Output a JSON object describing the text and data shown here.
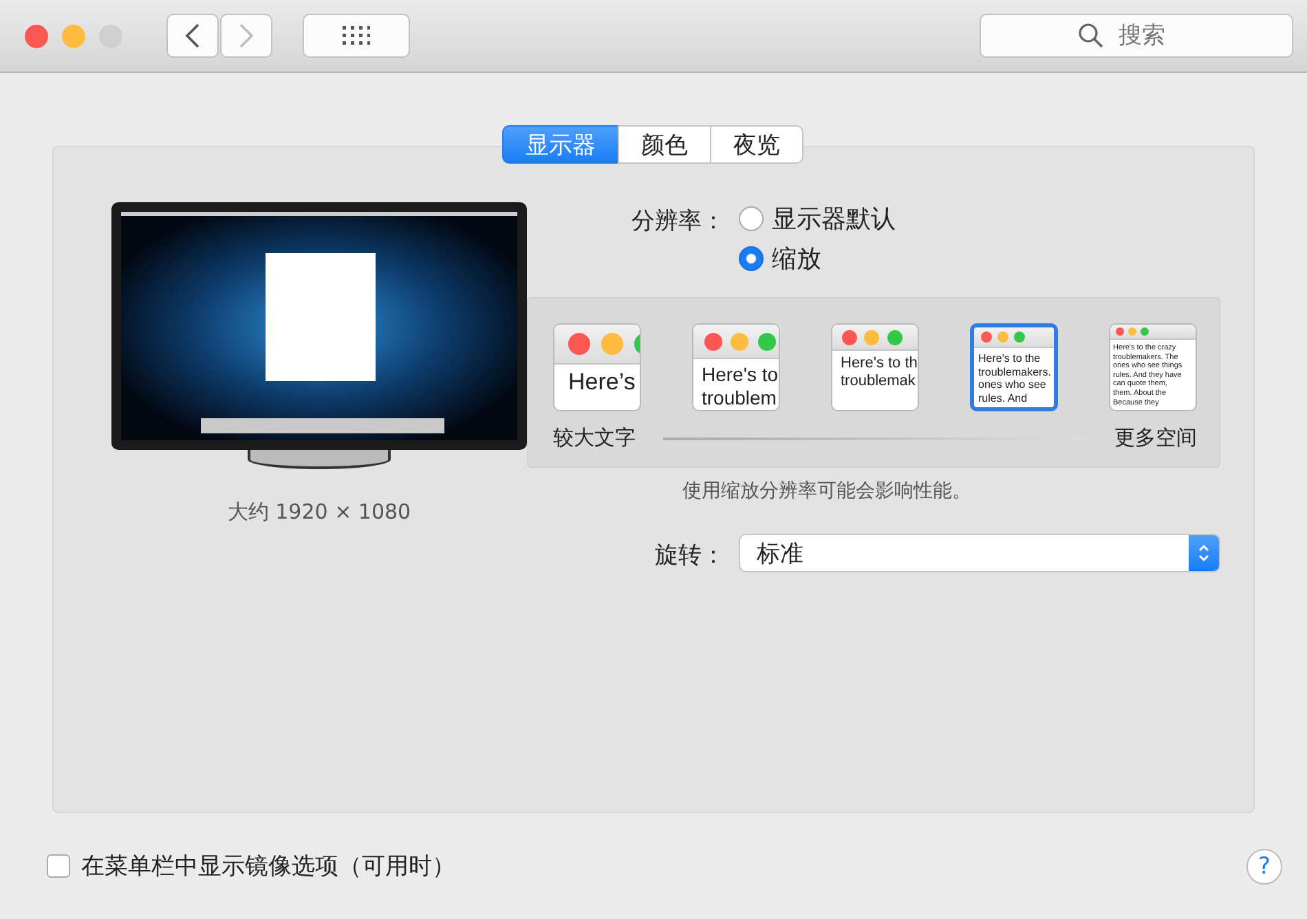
{
  "toolbar": {
    "back_disabled": false,
    "forward_disabled": true,
    "search": {
      "placeholder": "搜索"
    }
  },
  "tabs": [
    {
      "label": "显示器",
      "selected": true
    },
    {
      "label": "颜色",
      "selected": false
    },
    {
      "label": "夜览",
      "selected": false
    }
  ],
  "display": {
    "caption": "大约 1920 × 1080"
  },
  "resolution": {
    "label": "分辨率：",
    "options": [
      {
        "label": "显示器默认",
        "selected": false
      },
      {
        "label": "缩放",
        "selected": true
      }
    ]
  },
  "scaled": {
    "options": [
      {
        "lines": [
          "Here’s"
        ],
        "selected": false
      },
      {
        "lines": [
          "Here's to",
          "troublem"
        ],
        "selected": false
      },
      {
        "lines": [
          "Here's to th",
          "troublemak"
        ],
        "selected": false
      },
      {
        "lines": [
          "Here's to the",
          "troublemakers.",
          "ones who see",
          "rules. And"
        ],
        "selected": true
      },
      {
        "lines": [
          "Here's to the crazy",
          "troublemakers. The",
          "ones who see things",
          "rules. And they have",
          "can quote them,",
          "them. About the",
          "Because they"
        ],
        "selected": false
      }
    ],
    "left_label": "较大文字",
    "right_label": "更多空间"
  },
  "note": "使用缩放分辨率可能会影响性能。",
  "rotation": {
    "label": "旋转：",
    "value": "标准"
  },
  "mirror": {
    "label": "在菜单栏中显示镜像选项（可用时）",
    "checked": false
  },
  "help": "?"
}
